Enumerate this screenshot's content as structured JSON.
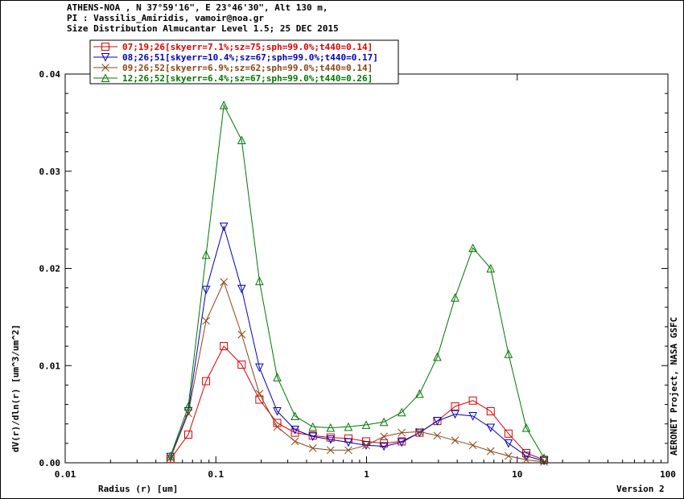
{
  "header": {
    "line1": "ATHENS-NOA , N 37°59'16\", E 23°46'30\", Alt 130 m,",
    "line2": "PI : Vassilis_Amiridis, vamoir@noa.gr",
    "line3": "Size Distribution Almucantar Level 1.5; 25 DEC 2015"
  },
  "side_label": "AERONET Project, NASA GSFC",
  "version_label": "Version 2",
  "chart_data": {
    "type": "line",
    "xlabel": "Radius (r) [um]",
    "ylabel": "dV(r)/dln(r) [um^3/um^2]",
    "x_scale": "log",
    "xlim": [
      0.01,
      100
    ],
    "ylim": [
      0,
      0.04
    ],
    "x_ticks": [
      0.01,
      0.1,
      1,
      10,
      100
    ],
    "x_tick_labels": [
      "0.01",
      "0.1",
      "1",
      "10",
      "100"
    ],
    "y_ticks": [
      0,
      0.01,
      0.02,
      0.03,
      0.04
    ],
    "y_tick_labels": [
      "0.00",
      "0.01",
      "0.02",
      "0.03",
      "0.04"
    ],
    "legend_position": "top-left",
    "x": [
      0.05,
      0.0656,
      0.0861,
      0.113,
      0.1483,
      0.1946,
      0.2554,
      0.3352,
      0.4399,
      0.5773,
      0.7576,
      0.9942,
      1.3048,
      1.7123,
      2.2471,
      2.949,
      3.87,
      5.0788,
      6.6651,
      8.7469,
      11.4789,
      15.0642
    ],
    "series": [
      {
        "name": "07;19;26[skyerr=7.1%;sz=75;sph=99.0%;t440=0.14]",
        "color": "#dd0000",
        "marker": "square",
        "values": [
          0.0004,
          0.0029,
          0.0084,
          0.012,
          0.0101,
          0.0065,
          0.0041,
          0.0031,
          0.0028,
          0.0026,
          0.0025,
          0.0022,
          0.002,
          0.0022,
          0.0031,
          0.0043,
          0.0058,
          0.0064,
          0.0053,
          0.003,
          0.001,
          0.0003
        ]
      },
      {
        "name": "08;26;51[skyerr=10.4%;sz=67;sph=99.0%;t440=0.17]",
        "color": "#0000bb",
        "marker": "triangle-down",
        "values": [
          0.0006,
          0.0053,
          0.0178,
          0.0243,
          0.0179,
          0.0098,
          0.0053,
          0.0034,
          0.0027,
          0.0024,
          0.0021,
          0.0018,
          0.0017,
          0.0021,
          0.0031,
          0.0043,
          0.005,
          0.0048,
          0.0036,
          0.002,
          0.0007,
          0.0002
        ]
      },
      {
        "name": "09;26;52[skyerr=6.9%;sz=62;sph=99.0%;t440=0.14]",
        "color": "#8b4513",
        "marker": "x",
        "values": [
          0.0005,
          0.0051,
          0.0146,
          0.0186,
          0.0132,
          0.0071,
          0.0037,
          0.0022,
          0.0015,
          0.0013,
          0.0013,
          0.0018,
          0.0027,
          0.0031,
          0.0032,
          0.0028,
          0.0023,
          0.0018,
          0.0012,
          0.0007,
          0.0003,
          0.0001
        ]
      },
      {
        "name": "12;26;52[skyerr=6.4%;sz=67;sph=99.0%;t440=0.26]",
        "color": "#007700",
        "marker": "triangle-up",
        "values": [
          0.0007,
          0.0058,
          0.0214,
          0.0368,
          0.0332,
          0.0187,
          0.0088,
          0.0048,
          0.0037,
          0.0036,
          0.0037,
          0.0039,
          0.0042,
          0.0052,
          0.0071,
          0.0109,
          0.017,
          0.0221,
          0.02,
          0.0112,
          0.0036,
          0.0005
        ]
      }
    ]
  }
}
